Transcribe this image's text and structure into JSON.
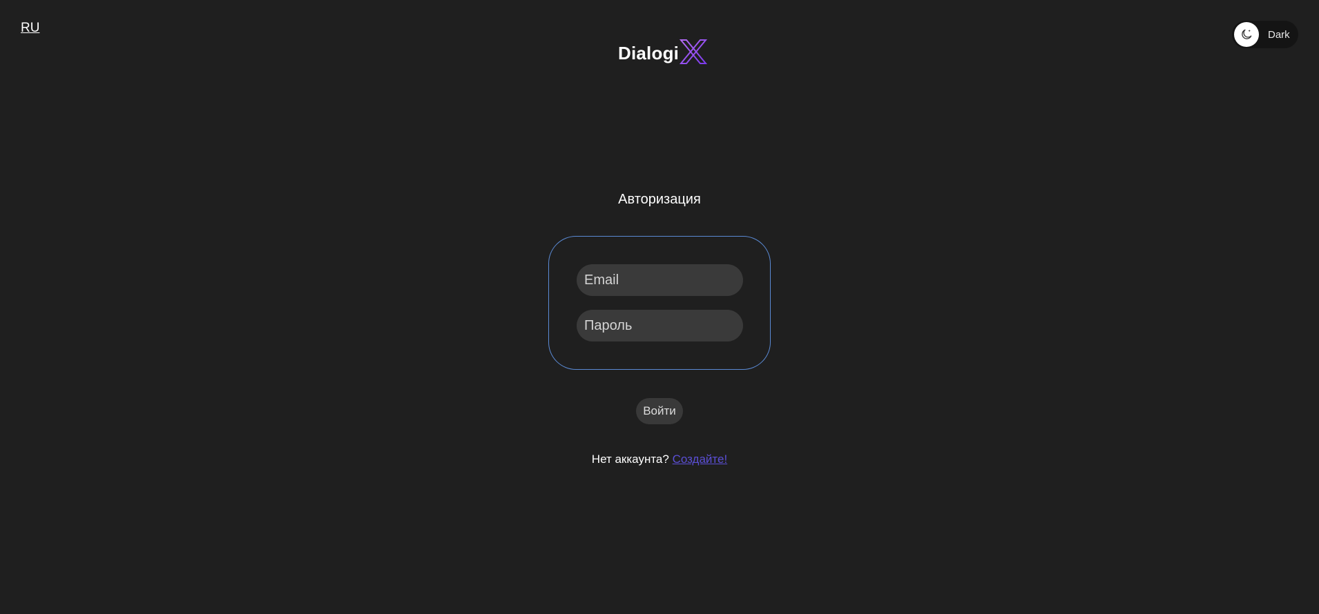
{
  "header": {
    "language_label": "RU",
    "theme_toggle": {
      "label": "Dark",
      "icon": "moon-icon"
    },
    "logo": {
      "text": "Dialogi",
      "mark_letter": "X",
      "mark_colors": [
        "#a855f7",
        "#7c3aed"
      ]
    }
  },
  "auth": {
    "title": "Авторизация",
    "email_placeholder": "Email",
    "email_value": "",
    "password_placeholder": "Пароль",
    "password_value": "",
    "submit_label": "Войти",
    "no_account_text": "Нет аккаунта?",
    "create_link_label": "Создайте!"
  },
  "colors": {
    "background": "#1f1f1f",
    "card_border": "#5b8bd6",
    "input_background": "#3a3a3a",
    "link": "#5b4fd6"
  }
}
